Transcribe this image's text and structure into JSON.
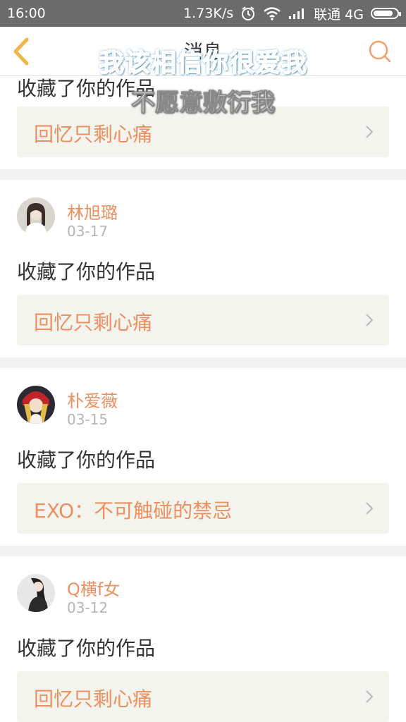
{
  "status_bar": {
    "time": "16:00",
    "speed": "1.73K/s",
    "carrier": "联通 4G",
    "icons": [
      "alarm-icon",
      "wifi-icon",
      "signal-icon",
      "battery-icon"
    ],
    "battery_level": 0.85
  },
  "header": {
    "title": "消息",
    "back_icon": "chevron-left-icon",
    "search_icon": "search-icon",
    "accent_color": "#f0a070"
  },
  "overlay": {
    "line1": "我该相信你很爱我",
    "line2": "不愿意敷衍我"
  },
  "notifications": [
    {
      "name": "",
      "date": "",
      "action": "收藏了你的作品",
      "work": "回忆只剩心痛"
    },
    {
      "name": "林旭璐",
      "date": "03-17",
      "action": "收藏了你的作品",
      "work": "回忆只剩心痛"
    },
    {
      "name": "朴爱薇",
      "date": "03-15",
      "action": "收藏了你的作品",
      "work": "EXO：不可触碰的禁忌"
    },
    {
      "name": "Q横f女",
      "date": "03-12",
      "action": "收藏了你的作品",
      "work": "回忆只剩心痛"
    }
  ],
  "colors": {
    "name": "#ee8f5f",
    "work": "#ee8f5f",
    "box_bg": "#f4f4ef",
    "separator": "#f2f2f2",
    "status_bg": "#6b6b6b"
  }
}
